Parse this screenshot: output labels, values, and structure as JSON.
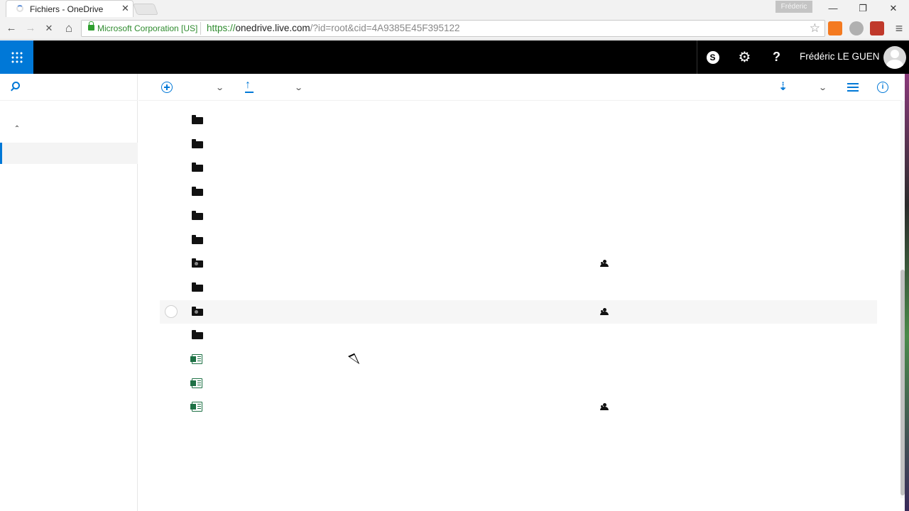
{
  "browser": {
    "tab_title": "Fichiers - OneDrive",
    "tab_close": "✕",
    "profile_name": "Fréderic",
    "window_controls": {
      "minimize": "—",
      "restore": "❐",
      "close": "✕"
    },
    "nav": {
      "back": "←",
      "forward": "→",
      "stop": "✕",
      "home": "⌂"
    },
    "ev_certificate": "Microsoft Corporation [US]",
    "url_scheme": "https://",
    "url_host": "onedrive.live.com",
    "url_path": "/?id=root&cid=4A9385E45F395122",
    "bookmark_star": "☆",
    "menu": "≡",
    "extension_colors": [
      "#f47a20",
      "#b0b0b0",
      "#c0392b"
    ]
  },
  "suitebar": {
    "skype_glyph": "S",
    "settings_glyph": "⚙",
    "help_glyph": "?",
    "user_name": "Frédéric LE GUEN",
    "accent_color": "#0078d7"
  },
  "leftpane": {
    "collapse_glyph": "⌃"
  },
  "commandbar": {
    "dropdown_glyph": "⌄",
    "sort_glyph": "⇣",
    "info_glyph": "i"
  },
  "files": [
    {
      "type": "folder",
      "shared": false
    },
    {
      "type": "folder",
      "shared": false
    },
    {
      "type": "folder",
      "shared": false
    },
    {
      "type": "folder",
      "shared": false
    },
    {
      "type": "folder",
      "shared": false
    },
    {
      "type": "folder",
      "shared": false
    },
    {
      "type": "shared-folder",
      "shared": true
    },
    {
      "type": "folder",
      "shared": false
    },
    {
      "type": "shared-folder",
      "shared": true,
      "hovered": true
    },
    {
      "type": "folder",
      "shared": false
    },
    {
      "type": "excel",
      "shared": false
    },
    {
      "type": "excel",
      "shared": false
    },
    {
      "type": "excel",
      "shared": true
    }
  ]
}
